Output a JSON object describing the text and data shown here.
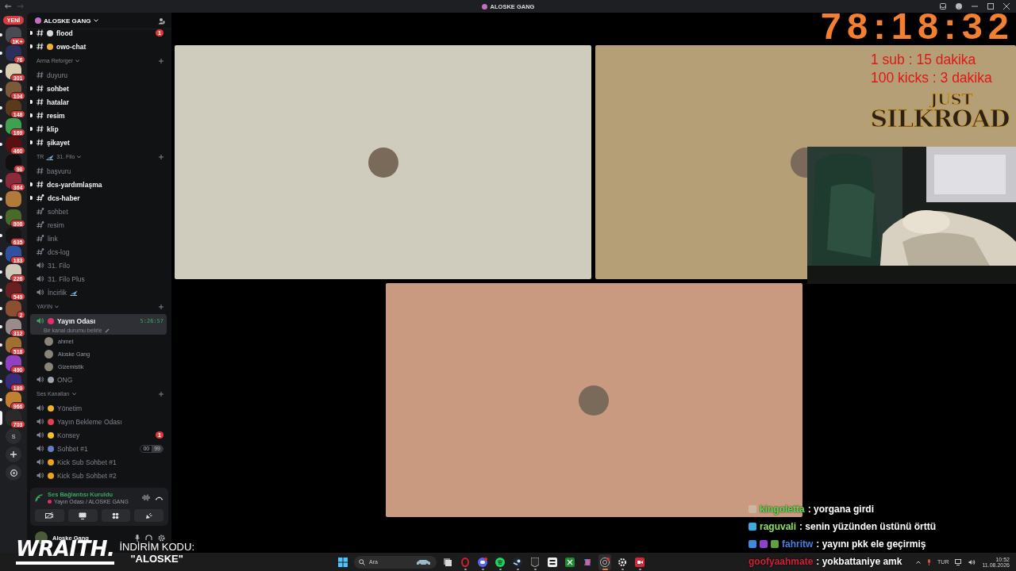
{
  "window": {
    "title": "ALOSKE GANG"
  },
  "server_rail": {
    "new_label": "YENİ",
    "servers": [
      {
        "badge": "1K+",
        "color": "#4a4a52",
        "unread": true,
        "selected": false
      },
      {
        "badge": "76",
        "color": "#2b2f5a",
        "unread": true,
        "selected": false
      },
      {
        "badge": "301",
        "color": "#d9cfae",
        "unread": true,
        "selected": false
      },
      {
        "badge": "104",
        "color": "#7a5a3a",
        "unread": true,
        "selected": false
      },
      {
        "badge": "148",
        "color": "#5a3a1a",
        "unread": true,
        "selected": false
      },
      {
        "badge": "169",
        "color": "#3fa050",
        "unread": true,
        "selected": false
      },
      {
        "badge": "460",
        "color": "#5a1010",
        "unread": true,
        "selected": false
      },
      {
        "badge": "98",
        "color": "#101010",
        "unread": false,
        "selected": false
      },
      {
        "badge": "364",
        "color": "#8a2a3a",
        "unread": true,
        "selected": false
      },
      {
        "color": "#b07a3a",
        "unread": true,
        "selected": false
      },
      {
        "badge": "808",
        "color": "#4a6a2a",
        "unread": true,
        "selected": false
      },
      {
        "badge": "635",
        "color": "#151515",
        "unread": true,
        "selected": false
      },
      {
        "badge": "183",
        "color": "#3050a0",
        "unread": true,
        "selected": false
      },
      {
        "badge": "226",
        "color": "#d0c8b8",
        "unread": true,
        "selected": false
      },
      {
        "badge": "549",
        "color": "#6a2020",
        "unread": true,
        "selected": false
      },
      {
        "badge": "2",
        "color": "#8a5030",
        "unread": true,
        "selected": false
      },
      {
        "badge": "312",
        "color": "#9a8a8a",
        "unread": true,
        "selected": false
      },
      {
        "badge": "518",
        "color": "#a07030",
        "unread": true,
        "selected": false
      },
      {
        "badge": "490",
        "color": "#9040c0",
        "unread": true,
        "selected": false
      },
      {
        "badge": "189",
        "color": "#3a2a7a",
        "unread": true,
        "selected": false
      },
      {
        "badge": "966",
        "color": "#c08030",
        "unread": true,
        "selected": false
      },
      {
        "badge": "703",
        "color": "#2a2a2a",
        "unread": false,
        "selected": true
      }
    ],
    "actions": [
      {
        "kind": "letter",
        "label": "S"
      },
      {
        "kind": "add"
      },
      {
        "kind": "discover"
      }
    ]
  },
  "channel_list": {
    "server_name": "ALOSKE GANG",
    "sections": [
      {
        "channels": [
          {
            "kind": "text",
            "name": "flood",
            "unread": true,
            "selected": false,
            "color": "#d8d8d8",
            "badge": "1"
          },
          {
            "kind": "text",
            "name": "owo-chat",
            "unread": true,
            "selected": false,
            "color": "#f0b030"
          }
        ]
      },
      {
        "title": "Arma Reforger",
        "channels": [
          {
            "kind": "text",
            "name": "duyuru",
            "unread": false,
            "selected": false
          },
          {
            "kind": "text",
            "name": "sohbet",
            "unread": true,
            "selected": false
          },
          {
            "kind": "text",
            "name": "hatalar",
            "unread": true,
            "selected": false
          },
          {
            "kind": "text",
            "name": "resim",
            "unread": true,
            "selected": false
          },
          {
            "kind": "text",
            "name": "klip",
            "unread": true,
            "selected": false
          },
          {
            "kind": "text",
            "name": "şikayet",
            "unread": true,
            "selected": false
          }
        ]
      },
      {
        "title": "31. Filo",
        "prefix": "TR",
        "channels": [
          {
            "kind": "text",
            "name": "başvuru",
            "unread": false,
            "selected": false
          },
          {
            "kind": "text",
            "name": "dcs-yardımlaşma",
            "unread": true,
            "selected": false
          },
          {
            "kind": "thread",
            "name": "dcs-haber",
            "unread": true,
            "selected": false
          },
          {
            "kind": "thread",
            "name": "sohbet",
            "unread": false,
            "selected": false
          },
          {
            "kind": "thread",
            "name": "resim",
            "unread": false,
            "selected": false
          },
          {
            "kind": "thread",
            "name": "link",
            "unread": false,
            "selected": false
          },
          {
            "kind": "thread",
            "name": "dcs-log",
            "unread": false,
            "selected": false
          },
          {
            "kind": "voice",
            "name": "31. Filo",
            "unread": false,
            "selected": false
          },
          {
            "kind": "voice",
            "name": "31. Filo Plus",
            "unread": false,
            "selected": false
          },
          {
            "kind": "voice",
            "name": "İncirlik",
            "unread": false,
            "selected": false,
            "plane": true
          }
        ]
      },
      {
        "title": "YAYIN",
        "channels": [
          {
            "kind": "voice",
            "name": "Yayın Odası",
            "unread": false,
            "selected": true,
            "connected": true,
            "color": "#e0306a",
            "timer": "5:26:57",
            "status": "Bir kanal durumu belirle",
            "members": [
              {
                "name": "ahmet"
              },
              {
                "name": "Aloske Gang"
              },
              {
                "name": "Gizemistik"
              }
            ]
          },
          {
            "kind": "voice",
            "name": "ONG",
            "unread": false,
            "selected": false,
            "color": "#a0a4b0"
          }
        ]
      },
      {
        "title": "Ses Kanalları",
        "channels": [
          {
            "kind": "voice",
            "name": "Yönetim",
            "unread": false,
            "selected": false,
            "color": "#f0b030"
          },
          {
            "kind": "voice",
            "name": "Yayın Bekleme Odası",
            "unread": false,
            "selected": false,
            "color": "#e04050"
          },
          {
            "kind": "voice",
            "name": "Konsey",
            "unread": false,
            "selected": false,
            "color": "#f0c030",
            "badge": "1"
          },
          {
            "kind": "voice",
            "name": "Sohbet #1",
            "unread": false,
            "selected": false,
            "color": "#6080c0",
            "limit": [
              "00",
              "99"
            ]
          },
          {
            "kind": "voice",
            "name": "Kick Sub Sohbet #1",
            "unread": false,
            "selected": false,
            "color": "#f0a020"
          },
          {
            "kind": "voice",
            "name": "Kick Sub Sohbet #2",
            "unread": false,
            "selected": false,
            "color": "#f0a020"
          }
        ]
      }
    ]
  },
  "voice_panel": {
    "status": "Ses Bağlantısı Kuruldu",
    "location": "Yayın Odası / ALOSKE GANG"
  },
  "user_panel": {
    "name": "Aloske Gang"
  },
  "stream_tiles": [
    {
      "color": "#cfcbbd"
    },
    {
      "color": "#b49f77"
    },
    {
      "color": "#c99a80"
    }
  ],
  "overlay": {
    "timer": "78:18:32",
    "rules": [
      "1 sub : 15 dakika",
      "100 kicks : 3 dakika"
    ],
    "logo": [
      "JUST",
      "SILKROAD"
    ],
    "webcam": {
      "kind": "picture"
    }
  },
  "ad": {
    "brand": "WRAITH.",
    "code_label": "İNDİRİM KODU:",
    "code": "\"ALOSKE\""
  },
  "chat": [
    {
      "user": "kingoletta",
      "color": "#5fdc4c",
      "text": ": yorgana girdi",
      "badges": [
        {
          "color": "#c8b8a0"
        }
      ]
    },
    {
      "user": "raguvali",
      "color": "#8fe067",
      "text": ": senin yüzünden üstünü örttü",
      "badges": [
        {
          "color": "#40a8e0"
        }
      ]
    },
    {
      "user": "fahritw",
      "color": "#4a7fe0",
      "text": ": yayını pkk ele geçirmiş",
      "badges": [
        {
          "color": "#3a8ae0"
        },
        {
          "color": "#9040d0"
        },
        {
          "color": "#60a040"
        }
      ]
    },
    {
      "user": "goofyaahmate",
      "color": "#d0203a",
      "text": ": yokbattaniye amk"
    }
  ],
  "taskbar": {
    "search_placeholder": "Ara",
    "apps": [
      {
        "kind": "window",
        "running": false,
        "selected": false
      },
      {
        "kind": "ring",
        "running": true,
        "selected": false
      },
      {
        "kind": "chat",
        "running": true,
        "selected": false
      },
      {
        "kind": "music",
        "running": true,
        "selected": false
      },
      {
        "kind": "launcher",
        "running": true,
        "selected": false
      },
      {
        "kind": "store",
        "running": true,
        "selected": false
      },
      {
        "kind": "widget",
        "running": false,
        "selected": false
      },
      {
        "kind": "xbox",
        "running": false,
        "selected": false
      },
      {
        "kind": "copilot",
        "running": false,
        "selected": false
      },
      {
        "kind": "record",
        "running": true,
        "selected": true
      },
      {
        "kind": "gear",
        "running": true,
        "selected": false
      },
      {
        "kind": "camera",
        "running": true,
        "selected": false
      }
    ],
    "language": "TUR",
    "time": "10:52",
    "date": "11.08.2026"
  }
}
